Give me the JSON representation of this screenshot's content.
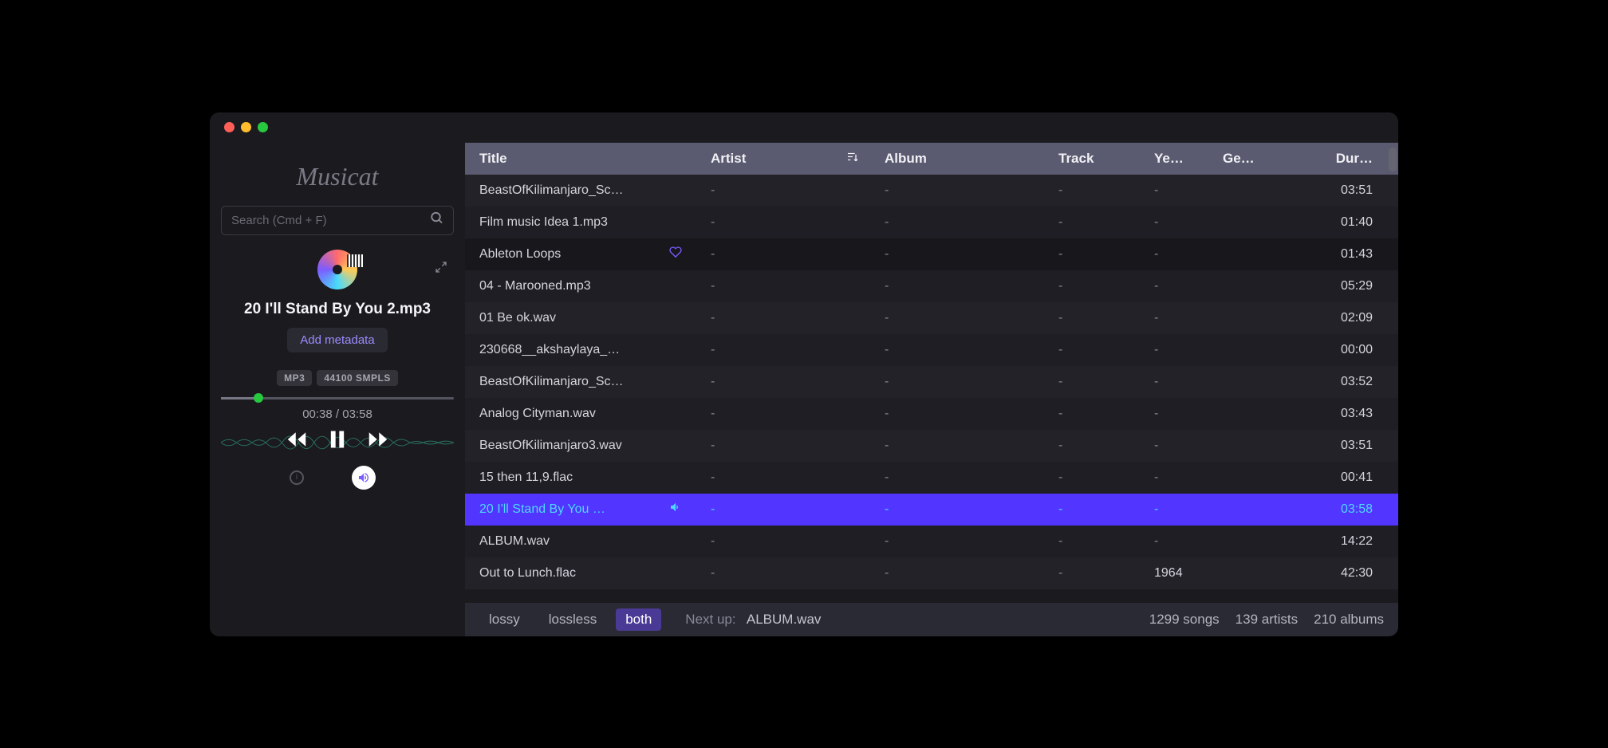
{
  "app": {
    "name": "Musicat"
  },
  "search": {
    "placeholder": "Search (Cmd + F)"
  },
  "nowPlaying": {
    "title": "20 I'll Stand By You 2.mp3",
    "addMetadataLabel": "Add metadata",
    "formatBadge": "MP3",
    "sampleBadge": "44100 SMPLS",
    "elapsed": "00:38",
    "total": "03:58",
    "timeSeparator": " / "
  },
  "columns": {
    "title": "Title",
    "artist": "Artist",
    "album": "Album",
    "track": "Track",
    "year": "Ye…",
    "genre": "Ge…",
    "duration": "Dur…"
  },
  "tracks": [
    {
      "title": "BeastOfKilimanjaro_Sc…",
      "artist": "-",
      "album": "-",
      "track": "-",
      "year": "-",
      "genre": "",
      "duration": "03:51",
      "favorite": false,
      "playing": false
    },
    {
      "title": "Film music Idea 1.mp3",
      "artist": "-",
      "album": "-",
      "track": "-",
      "year": "-",
      "genre": "",
      "duration": "01:40",
      "favorite": false,
      "playing": false
    },
    {
      "title": "Ableton Loops",
      "artist": "-",
      "album": "-",
      "track": "-",
      "year": "-",
      "genre": "",
      "duration": "01:43",
      "favorite": true,
      "playing": false,
      "hovered": true
    },
    {
      "title": "04 - Marooned.mp3",
      "artist": "-",
      "album": "-",
      "track": "-",
      "year": "-",
      "genre": "",
      "duration": "05:29",
      "favorite": false,
      "playing": false
    },
    {
      "title": "01 Be ok.wav",
      "artist": "-",
      "album": "-",
      "track": "-",
      "year": "-",
      "genre": "",
      "duration": "02:09",
      "favorite": false,
      "playing": false
    },
    {
      "title": "230668__akshaylaya_…",
      "artist": "-",
      "album": "-",
      "track": "-",
      "year": "-",
      "genre": "",
      "duration": "00:00",
      "favorite": false,
      "playing": false
    },
    {
      "title": "BeastOfKilimanjaro_Sc…",
      "artist": "-",
      "album": "-",
      "track": "-",
      "year": "-",
      "genre": "",
      "duration": "03:52",
      "favorite": false,
      "playing": false
    },
    {
      "title": "Analog Cityman.wav",
      "artist": "-",
      "album": "-",
      "track": "-",
      "year": "-",
      "genre": "",
      "duration": "03:43",
      "favorite": false,
      "playing": false
    },
    {
      "title": "BeastOfKilimanjaro3.wav",
      "artist": "-",
      "album": "-",
      "track": "-",
      "year": "-",
      "genre": "",
      "duration": "03:51",
      "favorite": false,
      "playing": false
    },
    {
      "title": "15 then 11,9.flac",
      "artist": "-",
      "album": "-",
      "track": "-",
      "year": "-",
      "genre": "",
      "duration": "00:41",
      "favorite": false,
      "playing": false
    },
    {
      "title": "20 I'll Stand By You …",
      "artist": "-",
      "album": "-",
      "track": "-",
      "year": "-",
      "genre": "",
      "duration": "03:58",
      "favorite": false,
      "playing": true
    },
    {
      "title": "ALBUM.wav",
      "artist": "-",
      "album": "-",
      "track": "-",
      "year": "-",
      "genre": "",
      "duration": "14:22",
      "favorite": false,
      "playing": false
    },
    {
      "title": "Out to Lunch.flac",
      "artist": "-",
      "album": "-",
      "track": "-",
      "year": "1964",
      "genre": "",
      "duration": "42:30",
      "favorite": false,
      "playing": false
    }
  ],
  "footer": {
    "filters": {
      "lossy": "lossy",
      "lossless": "lossless",
      "both": "both"
    },
    "nextUpLabel": "Next up:",
    "nextUpValue": "ALBUM.wav",
    "stats": {
      "songs": "1299 songs",
      "artists": "139 artists",
      "albums": "210 albums"
    }
  }
}
